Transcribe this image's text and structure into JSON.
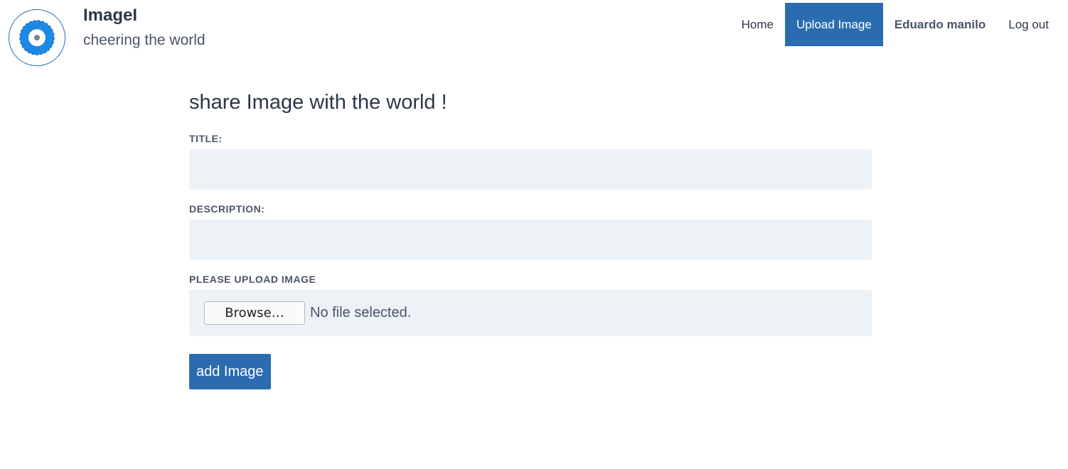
{
  "brand": {
    "title": "ImageI",
    "tagline": "cheering the world",
    "logo_icon": "camera-lens-icon",
    "accent_color": "#2b6cb0"
  },
  "nav": {
    "home": "Home",
    "upload": "Upload Image",
    "user": "Eduardo manilo",
    "logout": "Log out"
  },
  "form": {
    "heading": "share Image with the world !",
    "title_label": "TITLE:",
    "title_value": "",
    "description_label": "DESCRIPTION:",
    "description_value": "",
    "upload_label": "PLEASE UPLOAD IMAGE",
    "browse_label": "Browse…",
    "file_status": "No file selected.",
    "submit_label": "add Image"
  }
}
